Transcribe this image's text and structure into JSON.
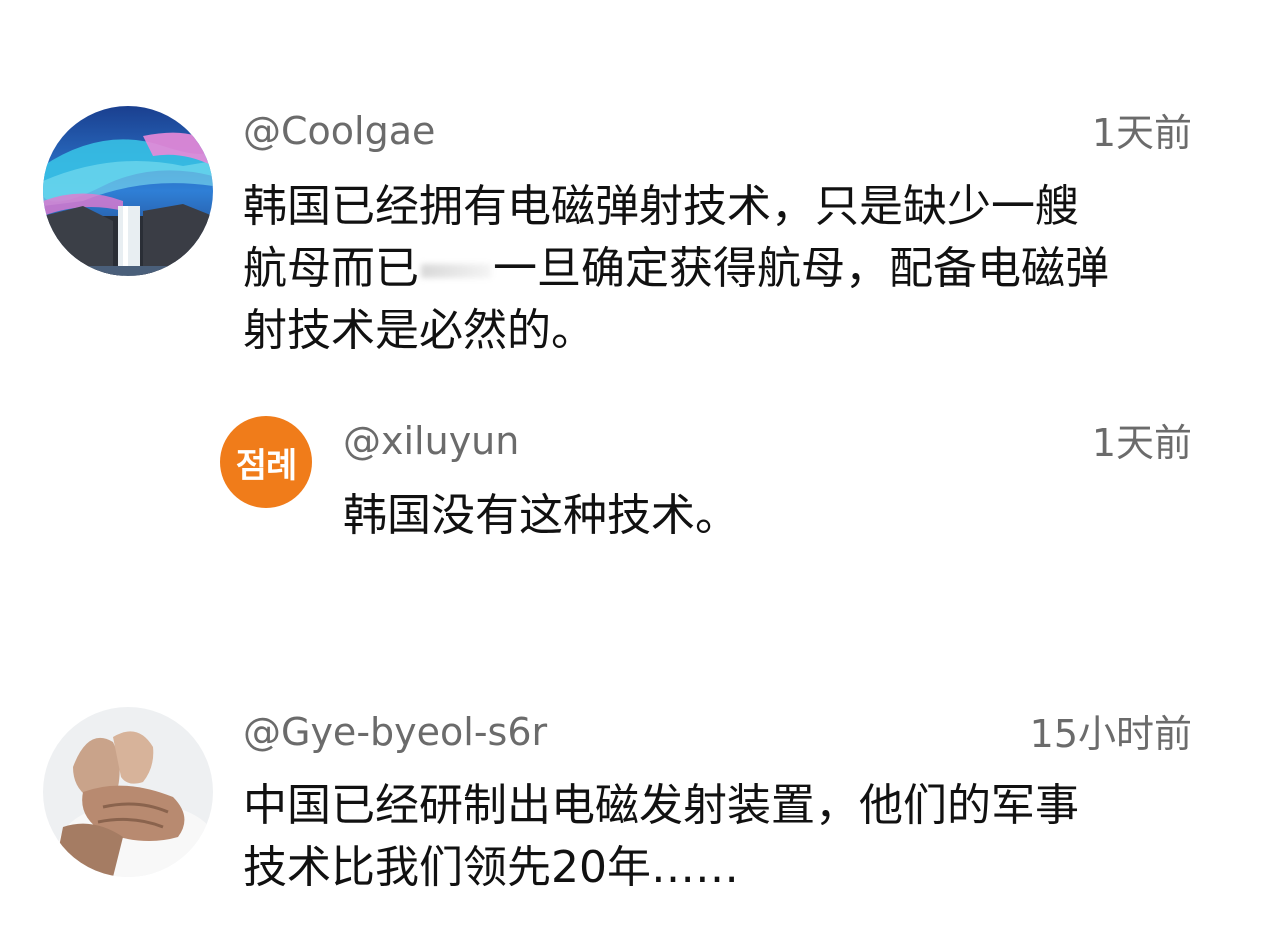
{
  "comments": [
    {
      "handle": "@Coolgae",
      "time": "1天前",
      "lines": [
        "韩国已经拥有电磁弹射技术，只是缺少一艘",
        "航母而已",
        "一旦确定获得航母，配备电磁弹",
        "射技术是必然的。"
      ]
    },
    {
      "handle": "@xiluyun",
      "time": "1天前",
      "avatar_text": "점례",
      "avatar_color": "#F07C1A",
      "lines": [
        "韩国没有这种技术。"
      ]
    },
    {
      "handle": "@Gye-byeol-s6r",
      "time": "15小时前",
      "lines": [
        "中国已经研制出电磁发射装置，他们的军事",
        "技术比我们领先20年……"
      ]
    }
  ],
  "colors": {
    "meta_text": "#6b6b6b",
    "body_text": "#111111",
    "background": "#ffffff"
  }
}
